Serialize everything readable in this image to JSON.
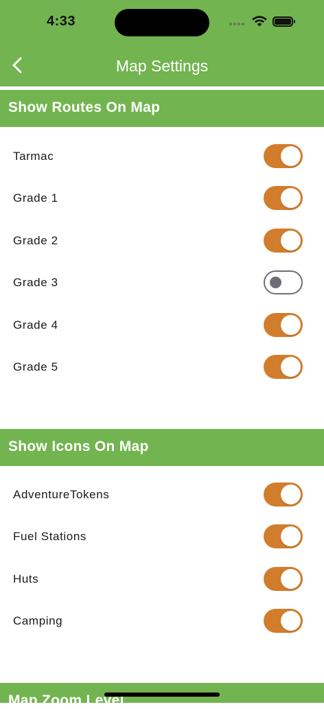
{
  "status_bar": {
    "time": "4:33"
  },
  "nav": {
    "title": "Map Settings",
    "back_icon": "chevron-left-icon"
  },
  "colors": {
    "accent_green": "#72b44f",
    "toggle_on": "#d27d2c",
    "toggle_off_border": "#6f6d76"
  },
  "sections": [
    {
      "title": "Show Routes On Map",
      "items": [
        {
          "label": "Tarmac",
          "enabled": true
        },
        {
          "label": "Grade 1",
          "enabled": true
        },
        {
          "label": "Grade 2",
          "enabled": true
        },
        {
          "label": "Grade 3",
          "enabled": false
        },
        {
          "label": "Grade 4",
          "enabled": true
        },
        {
          "label": "Grade 5",
          "enabled": true
        }
      ]
    },
    {
      "title": "Show Icons On Map",
      "items": [
        {
          "label": "AdventureTokens",
          "enabled": true
        },
        {
          "label": "Fuel Stations",
          "enabled": true
        },
        {
          "label": "Huts",
          "enabled": true
        },
        {
          "label": "Camping",
          "enabled": true
        }
      ]
    },
    {
      "title": "Map Zoom Level",
      "items": []
    }
  ]
}
